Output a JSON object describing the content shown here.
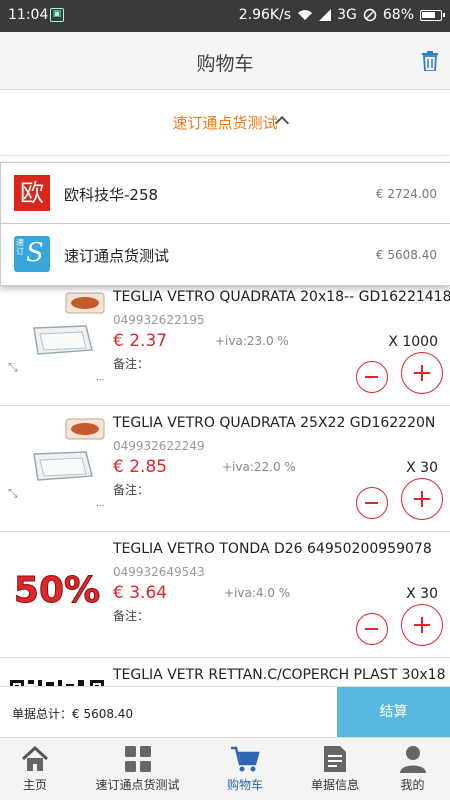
{
  "status_bar": {
    "time": "11:04",
    "speed": "2.96K/s",
    "network": "3G",
    "battery": "68%"
  },
  "header": {
    "title": "购物车",
    "trash_icon": "trash-icon"
  },
  "selector": {
    "label": "速订通点货测试",
    "icon": "chevron-up-icon"
  },
  "dropdown": {
    "items": [
      {
        "logo_text": "欧",
        "name": "欧科技华-258",
        "total": "€ 2724.00",
        "logo_color": "#d9261c"
      },
      {
        "logo_text": "速订",
        "logo_letter": "S",
        "name": "速订通点货测试",
        "total": "€ 5608.40",
        "logo_color": "#37a6dc"
      }
    ]
  },
  "cart": {
    "items": [
      {
        "name": "TEGLIA VETRO QUADRATA 20x18-- GD16221418",
        "code": "049932622195",
        "price": "€ 2.37",
        "iva": "+iva:23.0 %",
        "note": "备注：",
        "qty": "X 1000",
        "image": "glass-tray"
      },
      {
        "name": "TEGLIA VETRO QUADRATA 25X22 GD162220N",
        "code": "049932622249",
        "price": "€ 2.85",
        "iva": "+iva:22.0 %",
        "note": "备注：",
        "qty": "X 30",
        "image": "glass-tray"
      },
      {
        "name": "TEGLIA VETRO TONDA D26 64950200959078",
        "code": "049932649543",
        "price": "€ 3.64",
        "iva": "+iva:4.0 %",
        "note": "备注：",
        "qty": "X 30",
        "image": "fifty-percent",
        "image_text": "50%"
      },
      {
        "name": "TEGLIA VETR RETTAN.C/COPERCH PLAST 30x18",
        "code": "",
        "price": "",
        "iva": "",
        "note": "",
        "qty": "",
        "image": "qr-code"
      }
    ]
  },
  "footer": {
    "total": "单据总计：€ 5608.40",
    "checkout": "结算"
  },
  "bottom_nav": [
    {
      "label": "主页",
      "icon": "home-icon"
    },
    {
      "label": "速订通点货测试",
      "icon": "grid-icon"
    },
    {
      "label": "购物车",
      "icon": "cart-icon",
      "active": true
    },
    {
      "label": "单据信息",
      "icon": "document-icon"
    },
    {
      "label": "我的",
      "icon": "user-icon"
    }
  ],
  "colors": {
    "accent_orange": "#f07a1a",
    "price_red": "#e0262b",
    "checkout_blue": "#59b8e0",
    "active_nav_blue": "#2b67b2"
  }
}
